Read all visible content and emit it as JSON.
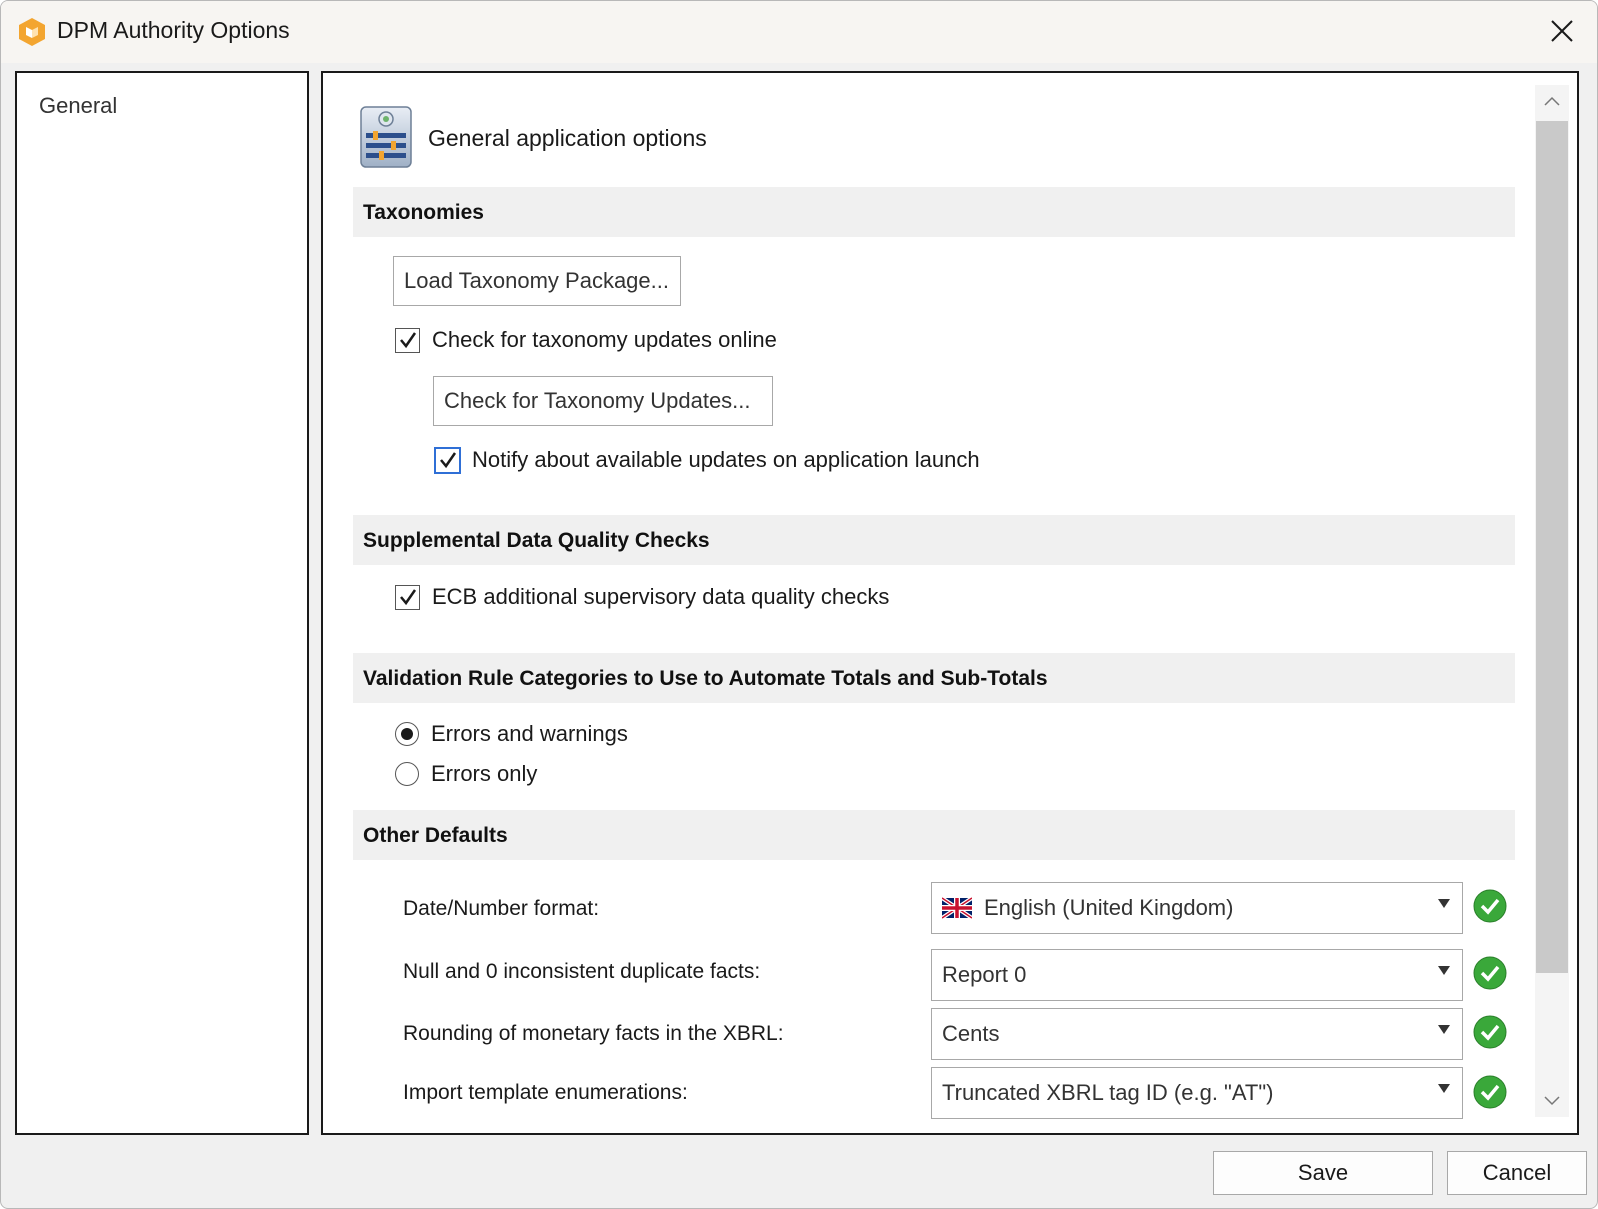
{
  "window": {
    "title": "DPM Authority Options",
    "close_icon": "close-icon",
    "app_icon": "altova-app-icon"
  },
  "nav": {
    "items": [
      {
        "label": "General",
        "selected": true
      }
    ]
  },
  "header": {
    "title": "General application options",
    "icon": "settings-sliders-icon"
  },
  "sections": {
    "taxonomies": {
      "title": "Taxonomies",
      "load_button": "Load Taxonomy Package...",
      "check_online_label": "Check for taxonomy updates online",
      "check_online_checked": true,
      "check_updates_button": "Check for Taxonomy Updates...",
      "notify_label": "Notify about available updates on application launch",
      "notify_checked": true
    },
    "quality": {
      "title": "Supplemental Data Quality Checks",
      "ecb_label": "ECB additional supervisory data quality checks",
      "ecb_checked": true
    },
    "validation": {
      "title": "Validation Rule Categories to Use to Automate Totals and Sub-Totals",
      "options": [
        {
          "label": "Errors and warnings",
          "selected": true
        },
        {
          "label": "Errors only",
          "selected": false
        }
      ]
    },
    "defaults": {
      "title": "Other Defaults",
      "fields": [
        {
          "label": "Date/Number format:",
          "value": "English (United Kingdom)",
          "flag": "uk-flag-icon",
          "status": "ok"
        },
        {
          "label": "Null and 0 inconsistent duplicate facts:",
          "value": "Report 0",
          "status": "ok"
        },
        {
          "label": "Rounding of monetary facts in the XBRL:",
          "value": "Cents",
          "status": "ok"
        },
        {
          "label": "Import template enumerations:",
          "value": "Truncated XBRL tag ID (e.g. \"AT\")",
          "status": "ok"
        }
      ]
    }
  },
  "footer": {
    "save_label": "Save",
    "cancel_label": "Cancel"
  },
  "colors": {
    "accent": "#2f6fd6",
    "ok_green": "#3aa83a",
    "section_bg": "#f0f0f0",
    "app_icon_orange": "#f3a530"
  }
}
